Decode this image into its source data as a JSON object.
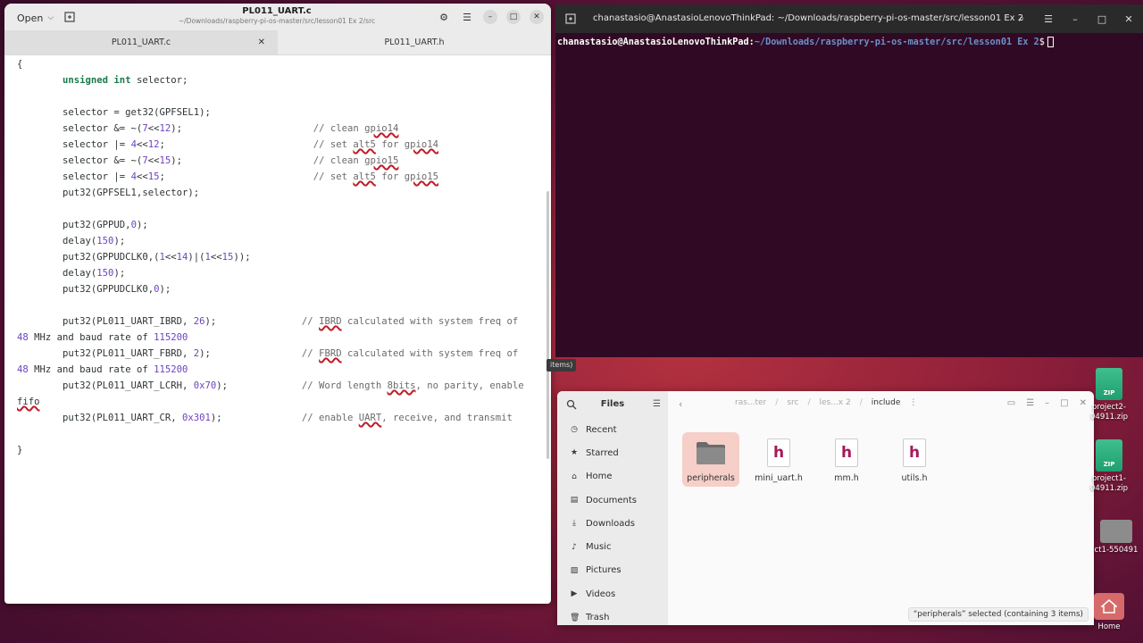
{
  "editor": {
    "open_label": "Open",
    "title": "PL011_UART.c",
    "subtitle": "~/Downloads/raspberry-pi-os-master/src/lesson01 Ex 2/src",
    "tabs": [
      {
        "label": "PL011_UART.c"
      },
      {
        "label": "PL011_UART.h"
      }
    ],
    "code": [
      "{",
      "        unsigned int selector;",
      "",
      "        selector = get32(GPFSEL1);",
      "        selector &= ~(7<<12);                       // clean gpio14",
      "        selector |= 4<<12;                          // set alt5 for gpio14",
      "        selector &= ~(7<<15);                       // clean gpio15",
      "        selector |= 4<<15;                          // set alt5 for gpio15",
      "        put32(GPFSEL1,selector);",
      "",
      "        put32(GPPUD,0);",
      "        delay(150);",
      "        put32(GPPUDCLK0,(1<<14)|(1<<15));",
      "        delay(150);",
      "        put32(GPPUDCLK0,0);",
      "",
      "        put32(PL011_UART_IBRD, 26);               // IBRD calculated with system freq of",
      "48 MHz and baud rate of 115200",
      "        put32(PL011_UART_FBRD, 2);                // FBRD calculated with system freq of",
      "48 MHz and baud rate of 115200",
      "        put32(PL011_UART_LCRH, 0x70);             // Word length 8bits, no parity, enable",
      "fifo",
      "        put32(PL011_UART_CR, 0x301);              // enable UART, receive, and transmit",
      "",
      "}"
    ]
  },
  "terminal": {
    "title": "chanastasio@AnastasioLenovoThinkPad: ~/Downloads/raspberry-pi-os-master/src/lesson01 Ex 2",
    "prompt_user": "chanastasio@AnastasioLenovoThinkPad",
    "prompt_path": "~/Downloads/raspberry-pi-os-master/src/lesson01 Ex 2",
    "prompt_symbol": "$"
  },
  "items_tooltip": "items)",
  "files": {
    "sidebar_title": "Files",
    "sidebar": [
      {
        "label": "Recent",
        "icon": "clock-icon"
      },
      {
        "label": "Starred",
        "icon": "star-icon"
      },
      {
        "label": "Home",
        "icon": "home-icon"
      },
      {
        "label": "Documents",
        "icon": "document-icon"
      },
      {
        "label": "Downloads",
        "icon": "download-icon"
      },
      {
        "label": "Music",
        "icon": "music-icon"
      },
      {
        "label": "Pictures",
        "icon": "picture-icon"
      },
      {
        "label": "Videos",
        "icon": "video-icon"
      },
      {
        "label": "Trash",
        "icon": "trash-icon"
      }
    ],
    "path": [
      "ras...ter",
      "src",
      "les...x 2",
      "include"
    ],
    "items": [
      {
        "label": "peripherals",
        "type": "folder",
        "selected": true
      },
      {
        "label": "mini_uart.h",
        "type": "header"
      },
      {
        "label": "mm.h",
        "type": "header"
      },
      {
        "label": "utils.h",
        "type": "header"
      }
    ],
    "status": "“peripherals” selected  (containing 3 items)"
  },
  "desktop": [
    {
      "label": "project2-\n04911.zip",
      "type": "zip"
    },
    {
      "label": "project1-\n04911.zip",
      "type": "zip"
    },
    {
      "label": "ct1-550491",
      "type": "file"
    },
    {
      "label": "Home",
      "type": "home"
    }
  ],
  "colors": {
    "terminal_bg": "#300a24",
    "prompt_path": "#6c8fc9",
    "header_icon": "#a6175a",
    "selection": "#f5cfc8"
  }
}
